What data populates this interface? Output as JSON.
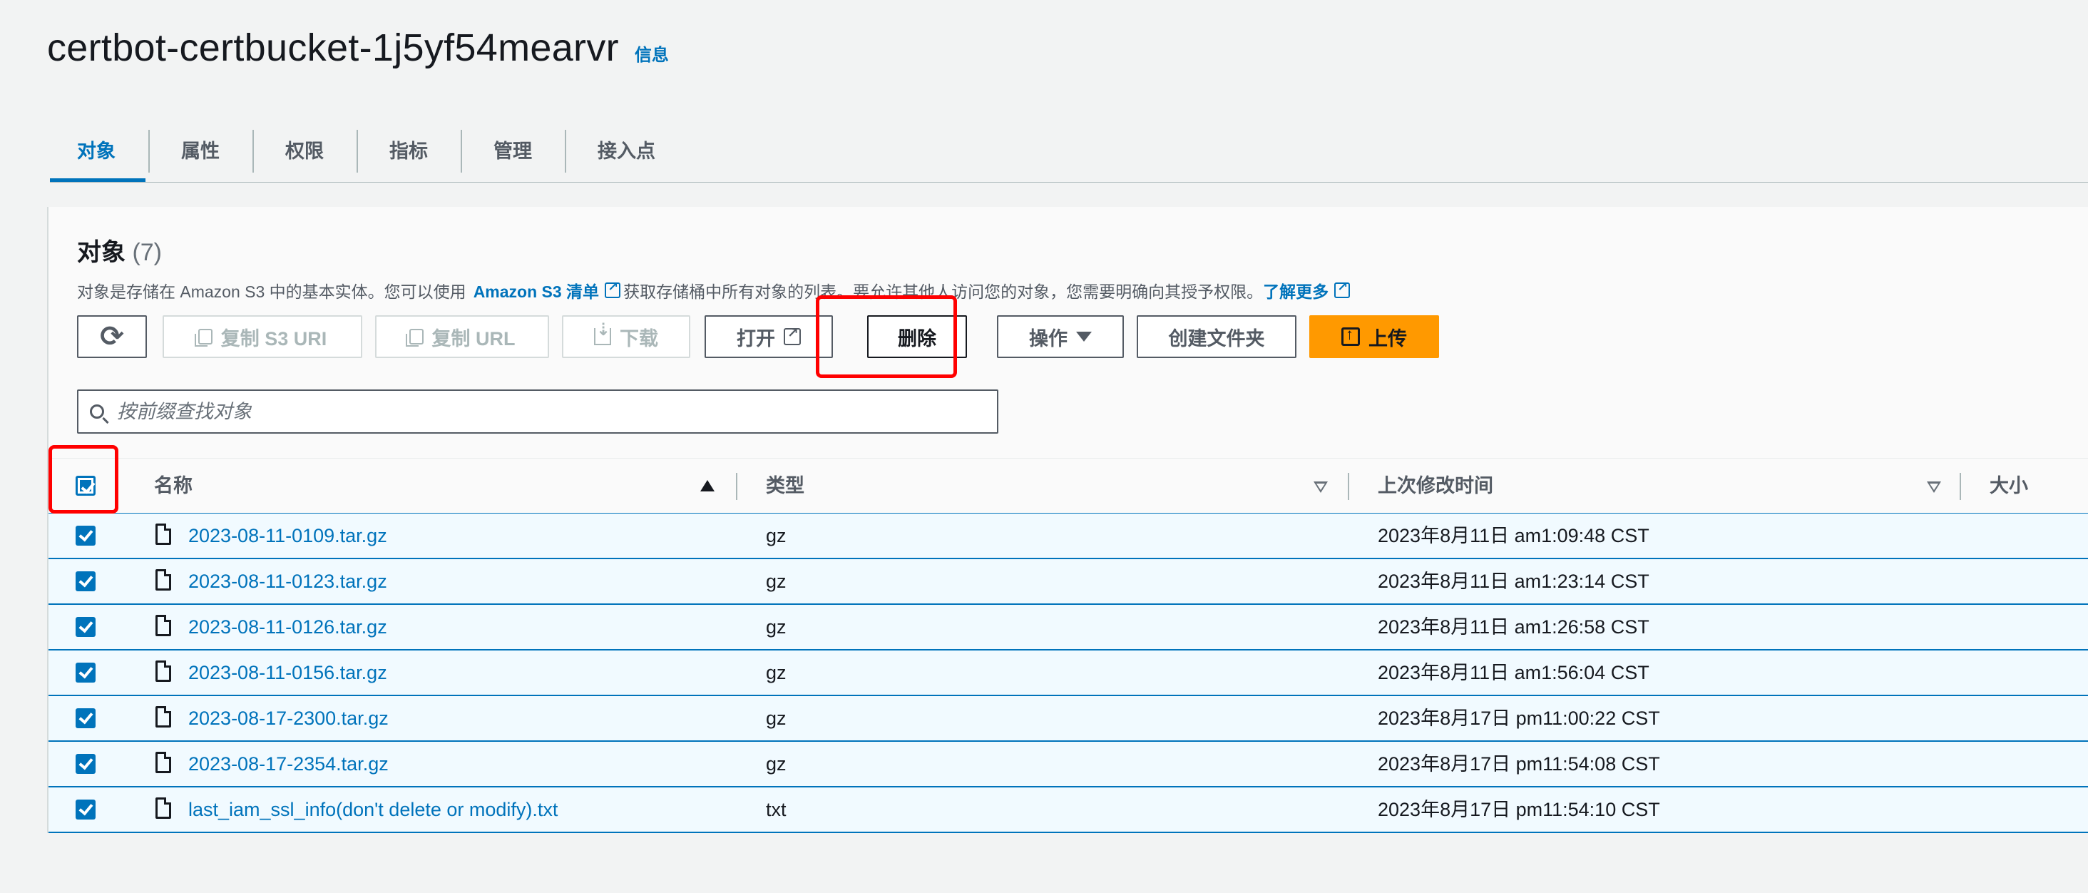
{
  "header": {
    "title": "certbot-certbucket-1j5yf54mearvr",
    "info": "信息"
  },
  "tabs": [
    "对象",
    "属性",
    "权限",
    "指标",
    "管理",
    "接入点"
  ],
  "panel": {
    "title": "对象",
    "count": "(7)",
    "description": {
      "part1": "对象是存储在 Amazon S3 中的基本实体。您可以使用",
      "link1": "Amazon S3 清单",
      "part2": "获取存储桶中所有对象的列表。要允许其他人访问您的对象，您需要明确向其授予权限。",
      "link2": "了解更多"
    }
  },
  "toolbar": {
    "copy_s3_uri": "复制 S3 URI",
    "copy_url": "复制 URL",
    "download": "下载",
    "open": "打开",
    "delete": "删除",
    "actions": "操作",
    "create_folder": "创建文件夹",
    "upload": "上传"
  },
  "search": {
    "placeholder": "按前缀查找对象"
  },
  "table": {
    "columns": {
      "name": "名称",
      "type": "类型",
      "modified": "上次修改时间",
      "size": "大小"
    },
    "rows": [
      {
        "name": "2023-08-11-0109.tar.gz",
        "type": "gz",
        "modified": "2023年8月11日 am1:09:48 CST"
      },
      {
        "name": "2023-08-11-0123.tar.gz",
        "type": "gz",
        "modified": "2023年8月11日 am1:23:14 CST"
      },
      {
        "name": "2023-08-11-0126.tar.gz",
        "type": "gz",
        "modified": "2023年8月11日 am1:26:58 CST"
      },
      {
        "name": "2023-08-11-0156.tar.gz",
        "type": "gz",
        "modified": "2023年8月11日 am1:56:04 CST"
      },
      {
        "name": "2023-08-17-2300.tar.gz",
        "type": "gz",
        "modified": "2023年8月17日 pm11:00:22 CST"
      },
      {
        "name": "2023-08-17-2354.tar.gz",
        "type": "gz",
        "modified": "2023年8月17日 pm11:54:08 CST"
      },
      {
        "name": "last_iam_ssl_info(don't delete or modify).txt",
        "type": "txt",
        "modified": "2023年8月17日 pm11:54:10 CST"
      }
    ]
  },
  "colors": {
    "accent": "#0073bb",
    "primary_button": "#ff9900",
    "highlight": "#ff0000"
  }
}
